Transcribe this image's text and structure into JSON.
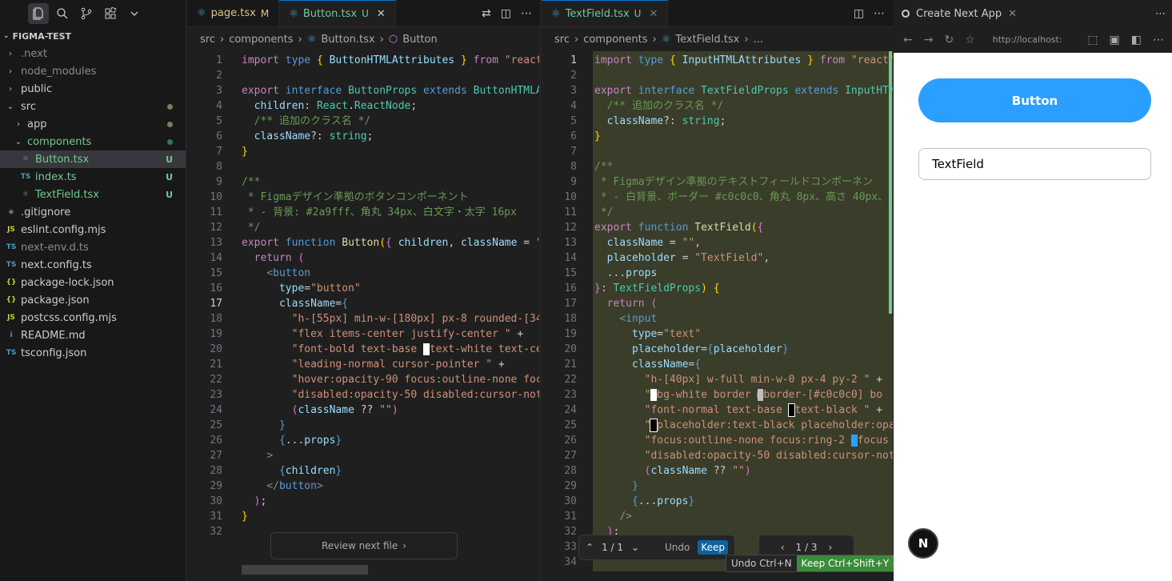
{
  "explorer": {
    "project": "FIGMA-TEST",
    "items": [
      {
        "label": ".next",
        "icon": "›"
      },
      {
        "label": "node_modules",
        "icon": "›"
      },
      {
        "label": "public",
        "icon": "›"
      },
      {
        "label": "src",
        "icon": "⌄"
      },
      {
        "label": "app",
        "icon": "›"
      },
      {
        "label": "components",
        "icon": "⌄"
      },
      {
        "label": "Button.tsx",
        "badge": "U"
      },
      {
        "label": "index.ts",
        "badge": "U"
      },
      {
        "label": "TextField.tsx",
        "badge": "U"
      },
      {
        "label": ".gitignore"
      },
      {
        "label": "eslint.config.mjs"
      },
      {
        "label": "next-env.d.ts"
      },
      {
        "label": "next.config.ts"
      },
      {
        "label": "package-lock.json"
      },
      {
        "label": "package.json"
      },
      {
        "label": "postcss.config.mjs"
      },
      {
        "label": "README.md"
      },
      {
        "label": "tsconfig.json"
      }
    ],
    "fi_js": "JS",
    "fi_ts": "TS",
    "fi_json": "{}",
    "fi_info": "i"
  },
  "left_editor": {
    "tabs": [
      {
        "label": "page.tsx",
        "mark": "M"
      },
      {
        "label": "Button.tsx",
        "mark": "U"
      }
    ],
    "close": "✕",
    "breadcrumb": [
      "src",
      "components",
      "Button.tsx",
      "Button"
    ],
    "review_label": "Review next file"
  },
  "right_editor": {
    "tab": {
      "label": "TextField.tsx",
      "mark": "U"
    },
    "breadcrumb": [
      "src",
      "components",
      "TextField.tsx",
      "..."
    ],
    "nav_count": "1 / 1",
    "undo": "Undo",
    "keep": "Keep",
    "file_count": "1 / 3",
    "tooltip_undo": "Undo Ctrl+N",
    "tooltip_keep": "Keep Ctrl+Shift+Y"
  },
  "browser": {
    "tab_title": "Create Next App",
    "url": "http://localhost:",
    "button_label": "Button",
    "textfield_placeholder": "TextField",
    "next_badge": "N"
  }
}
